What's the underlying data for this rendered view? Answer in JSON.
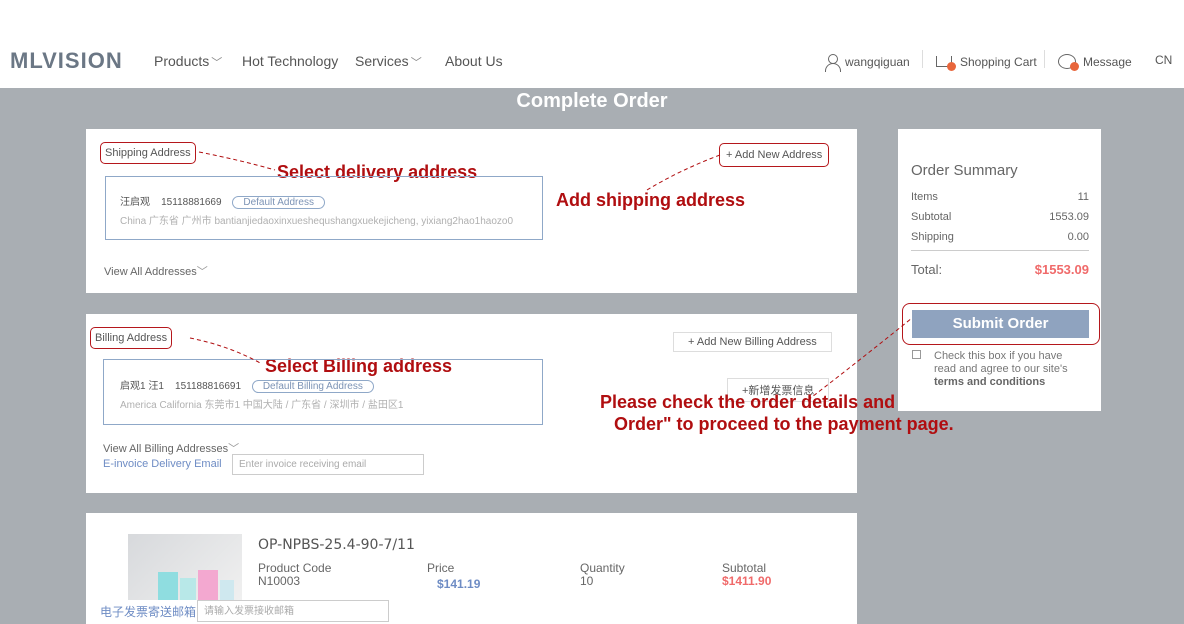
{
  "header": {
    "logo": "MLVISION",
    "nav": [
      {
        "label": "Products",
        "has_dropdown": true
      },
      {
        "label": "Hot Technology",
        "has_dropdown": false
      },
      {
        "label": "Services",
        "has_dropdown": true
      },
      {
        "label": "About Us",
        "has_dropdown": false
      }
    ],
    "user": "wangqiguan",
    "cart": "Shopping Cart",
    "message": "Message",
    "lang": "CN"
  },
  "page_title": "Complete Order",
  "shipping": {
    "label": "Shipping Address",
    "annotation": "Select delivery address",
    "add_button": "+ Add New Address",
    "add_annotation": "Add shipping address",
    "address": {
      "name": "汪启观",
      "phone": "15118881669",
      "tag": "Default Address",
      "line": "China  广东省  广州市  bantianjiedaoxinxueshequshangxuekejicheng, yixiang2hao1haozo0"
    },
    "view_all": "View All Addresses"
  },
  "billing": {
    "label": "Billing Address",
    "annotation": "Select Billing address",
    "add_button": "+ Add New Billing Address",
    "add_invoice_button": "+新增发票信息",
    "address": {
      "name": "启观1 汪1",
      "phone": "151188816691",
      "tag": "Default Billing Address",
      "line": "America  California  东莞市1  中国大陆 / 广东省 / 深圳市 / 盐田区1"
    },
    "view_all": "View All Billing Addresses",
    "email_label": "E-invoice Delivery Email",
    "email_placeholder": "Enter invoice receiving email"
  },
  "summary": {
    "title": "Order Summary",
    "rows": [
      {
        "label": "Items",
        "value": "11"
      },
      {
        "label": "Subtotal",
        "value": "1553.09"
      },
      {
        "label": "Shipping",
        "value": "0.00"
      }
    ],
    "total_label": "Total:",
    "total_value": "$1553.09",
    "submit": "Submit Order",
    "agree_line1": "Check this box if you have",
    "agree_line2": "read and agree to our site's",
    "agree_line3": "terms and conditions",
    "annotation_line1": "Please check the order details and click \"Submit",
    "annotation_line2": "Order\" to proceed to the payment page."
  },
  "product": {
    "name": "OP-NPBS-25.4-90-7/11",
    "code_label": "Product Code",
    "code": "N10003",
    "price_label": "Price",
    "price": "$141.19",
    "qty_label": "Quantity",
    "qty": "10",
    "subtotal_label": "Subtotal",
    "subtotal": "$1411.90"
  },
  "footer_email": {
    "label": "电子发票寄送邮箱",
    "placeholder": "请输入发票接收邮箱"
  },
  "colors": {
    "annotation_red": "#b00e10",
    "accent_blue": "#8fa3bf",
    "total_red": "#f06a6a",
    "price_blue": "#6e8cc4"
  }
}
